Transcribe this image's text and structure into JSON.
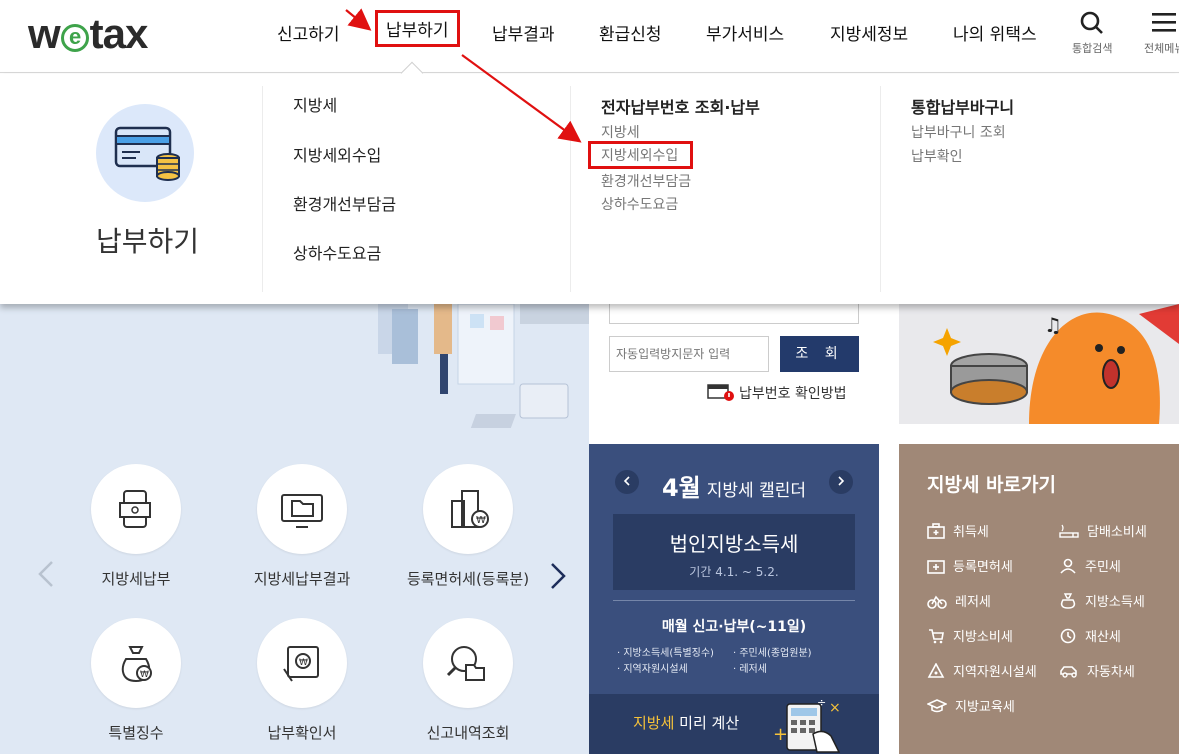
{
  "header": {
    "logo_prefix": "w",
    "logo_e": "e",
    "logo_suffix": "tax",
    "nav": [
      "신고하기",
      "납부하기",
      "납부결과",
      "환급신청",
      "부가서비스",
      "지방세정보",
      "나의 위택스"
    ],
    "search_label": "통합검색",
    "menu_label": "전체메뉴"
  },
  "mega": {
    "hero_title": "납부하기",
    "col1": [
      "지방세",
      "지방세외수입",
      "환경개선부담금",
      "상하수도요금"
    ],
    "col2": {
      "title": "전자납부번호 조회·납부",
      "items": [
        "지방세",
        "지방세외수입",
        "환경개선부담금",
        "상하수도요금"
      ]
    },
    "col3": {
      "title": "통합납부바구니",
      "items": [
        "납부바구니 조회",
        "납부확인"
      ]
    }
  },
  "search": {
    "captcha_placeholder": "자동입력방지문자 입력",
    "query_button": "조 회",
    "help_link": "납부번호 확인방법"
  },
  "quick": [
    "지방세납부",
    "지방세납부결과",
    "등록면허세(등록분)",
    "특별징수",
    "납부확인서",
    "신고내역조회"
  ],
  "calendar": {
    "month": "4월",
    "title": "지방세 캘린더",
    "card_title": "법인지방소득세",
    "card_period": "기간 4.1. ~ 5.2.",
    "monthly_title": "매월 신고·납부(~11일)",
    "monthly_items": [
      "지방소득세(특별징수)",
      "주민세(종업원분)",
      "지역자원시설세",
      "레저세"
    ],
    "calc_highlight": "지방세",
    "calc_rest": " 미리 계산"
  },
  "shortcuts": {
    "title": "지방세 바로가기",
    "items": [
      "취득세",
      "담배소비세",
      "등록면허세",
      "주민세",
      "레저세",
      "지방소득세",
      "지방소비세",
      "재산세",
      "지역자원시설세",
      "자동차세",
      "지방교육세"
    ]
  },
  "colors": {
    "navy": "#233a6b",
    "calendar_bg": "#3a4f7d",
    "shortcut_bg": "#a08877",
    "highlight_red": "#e01010",
    "logo_green": "#3ea34a"
  }
}
